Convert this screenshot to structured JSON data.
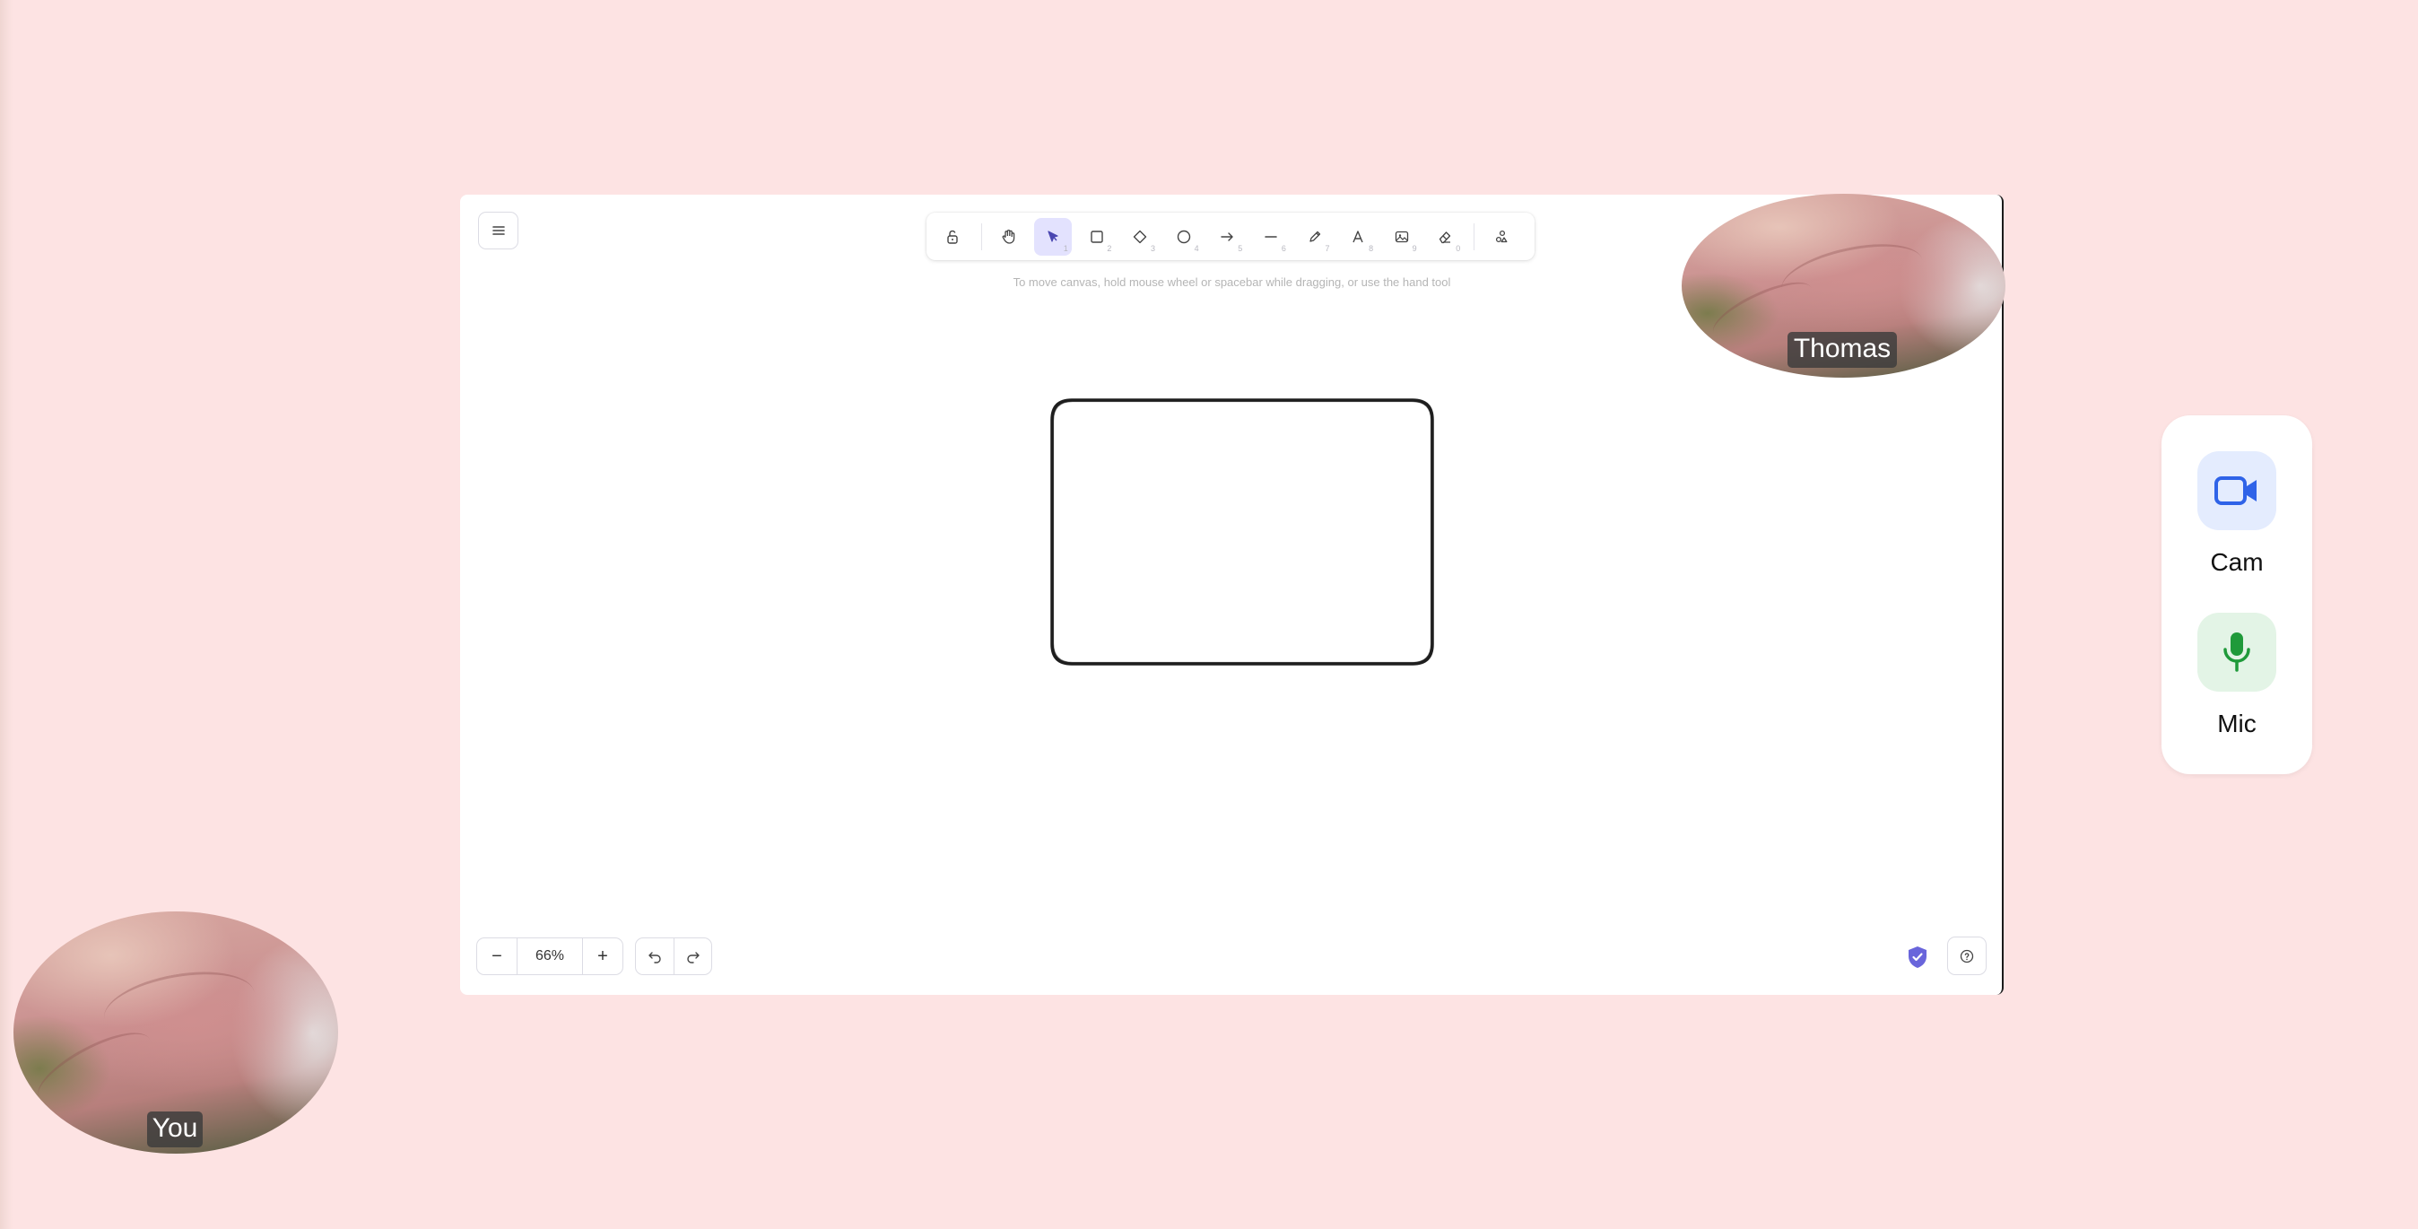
{
  "toolbar": {
    "tools": [
      {
        "name": "lock",
        "key": ""
      },
      {
        "name": "hand",
        "key": ""
      },
      {
        "name": "selection",
        "key": "1"
      },
      {
        "name": "rectangle",
        "key": "2"
      },
      {
        "name": "diamond",
        "key": "3"
      },
      {
        "name": "ellipse",
        "key": "4"
      },
      {
        "name": "arrow",
        "key": "5"
      },
      {
        "name": "line",
        "key": "6"
      },
      {
        "name": "draw",
        "key": "7"
      },
      {
        "name": "text",
        "key": "8"
      },
      {
        "name": "image",
        "key": "9"
      },
      {
        "name": "eraser",
        "key": "0"
      },
      {
        "name": "extra-tools",
        "key": ""
      }
    ],
    "active_tool": "selection"
  },
  "canvas": {
    "hint": "To move canvas, hold mouse wheel or spacebar while dragging, or use the hand tool"
  },
  "footer": {
    "zoom_out_label": "−",
    "zoom_level": "66%",
    "zoom_in_label": "+"
  },
  "videos": {
    "remote_name": "Thomas",
    "local_name": "You"
  },
  "media": {
    "cam_label": "Cam",
    "mic_label": "Mic",
    "cam_color": "#2f63e8",
    "mic_color": "#1f9a3a"
  },
  "colors": {
    "background": "#fde3e3",
    "accent": "#6965db",
    "active_tool_bg": "#e3e2fe"
  }
}
